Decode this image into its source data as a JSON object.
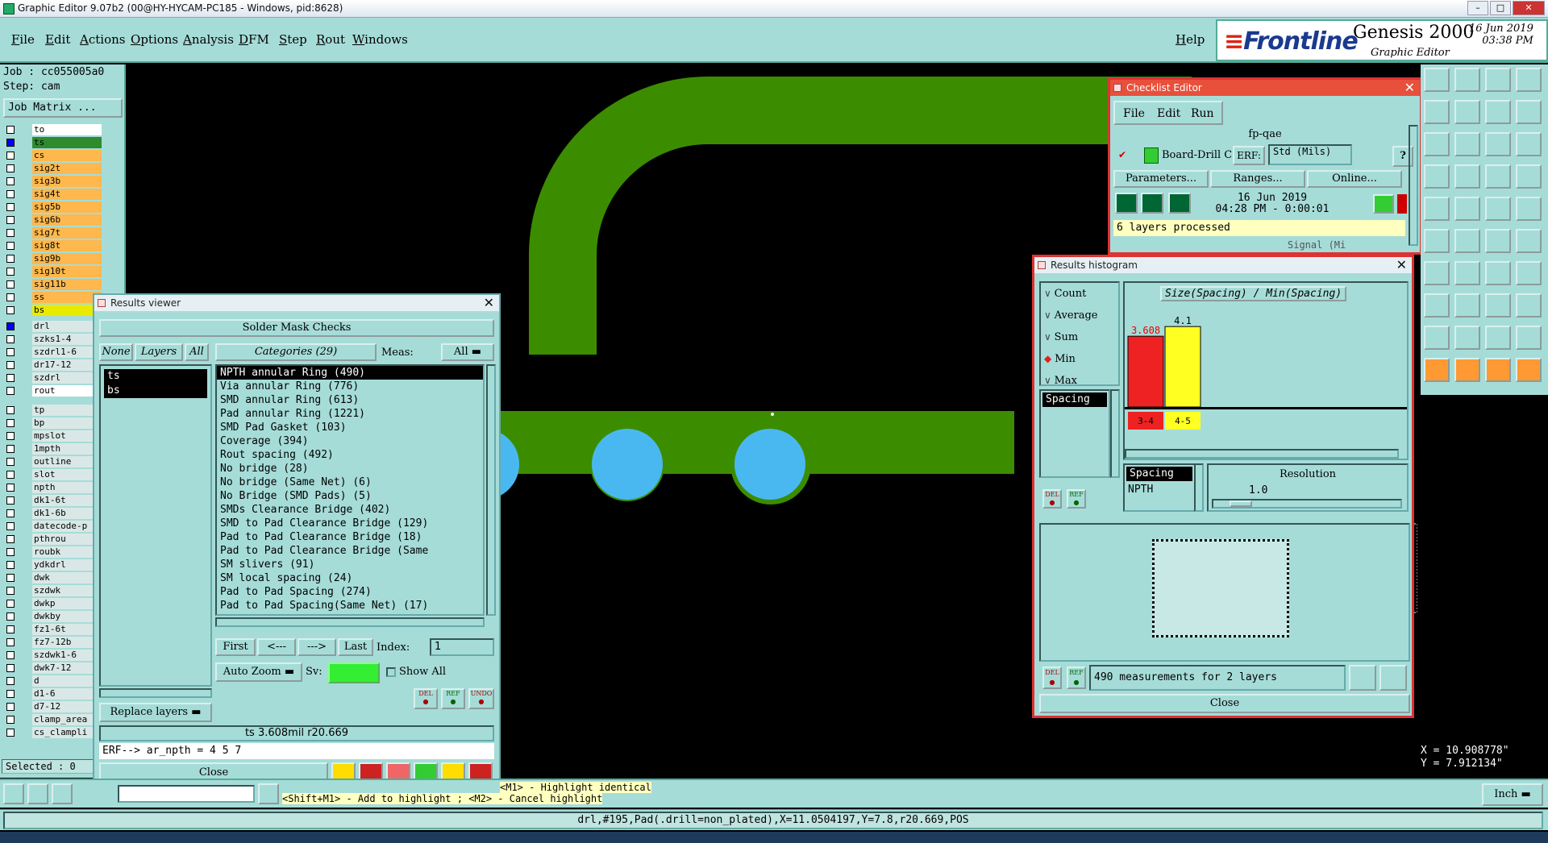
{
  "window": {
    "title": "Graphic Editor 9.07b2 (00@HY-HYCAM-PC185 - Windows, pid:8628)"
  },
  "menu": {
    "items": [
      "File",
      "Edit",
      "Actions",
      "Options",
      "Analysis",
      "DFM",
      "Step",
      "Rout",
      "Windows"
    ],
    "help": "Help"
  },
  "brand": {
    "logo": "Frontline",
    "product": "Genesis 2000",
    "subtitle": "Graphic Editor",
    "date": "16 Jun 2019",
    "time": "03:38 PM"
  },
  "left_panel": {
    "job": "Job : cc055005a0",
    "step": "Step: cam",
    "job_matrix": "Job Matrix ...",
    "layers": [
      {
        "name": "to",
        "style": "white",
        "checked": false
      },
      {
        "name": "ts",
        "style": "green",
        "checked": true
      },
      {
        "name": "cs",
        "style": "orange",
        "checked": false
      },
      {
        "name": "sig2t",
        "style": "orange",
        "checked": false
      },
      {
        "name": "sig3b",
        "style": "orange",
        "checked": false
      },
      {
        "name": "sig4t",
        "style": "orange",
        "checked": false
      },
      {
        "name": "sig5b",
        "style": "orange",
        "checked": false
      },
      {
        "name": "sig6b",
        "style": "orange",
        "checked": false
      },
      {
        "name": "sig7t",
        "style": "orange",
        "checked": false
      },
      {
        "name": "sig8t",
        "style": "orange",
        "checked": false
      },
      {
        "name": "sig9b",
        "style": "orange",
        "checked": false
      },
      {
        "name": "sig10t",
        "style": "orange",
        "checked": false
      },
      {
        "name": "sig11b",
        "style": "orange",
        "checked": false
      },
      {
        "name": "ss",
        "style": "orange",
        "checked": false
      },
      {
        "name": "bs",
        "style": "yellow",
        "checked": false
      },
      {
        "name": "drl",
        "style": "gray",
        "checked": true
      },
      {
        "name": "szks1-4",
        "style": "gray",
        "checked": false
      },
      {
        "name": "szdrl1-6",
        "style": "gray",
        "checked": false
      },
      {
        "name": "dr17-12",
        "style": "gray",
        "checked": false
      },
      {
        "name": "szdrl",
        "style": "gray",
        "checked": false
      },
      {
        "name": "rout",
        "style": "white",
        "checked": false
      },
      {
        "name": "tp",
        "style": "gray",
        "checked": false
      },
      {
        "name": "bp",
        "style": "gray",
        "checked": false
      },
      {
        "name": "mpslot",
        "style": "gray",
        "checked": false
      },
      {
        "name": "1mpth",
        "style": "gray",
        "checked": false
      },
      {
        "name": "outline",
        "style": "gray",
        "checked": false
      },
      {
        "name": "slot",
        "style": "gray",
        "checked": false
      },
      {
        "name": "npth",
        "style": "gray",
        "checked": false
      },
      {
        "name": "dk1-6t",
        "style": "gray",
        "checked": false
      },
      {
        "name": "dk1-6b",
        "style": "gray",
        "checked": false
      },
      {
        "name": "datecode-p",
        "style": "gray",
        "checked": false
      },
      {
        "name": "pthrou",
        "style": "gray",
        "checked": false
      },
      {
        "name": "roubk",
        "style": "gray",
        "checked": false
      },
      {
        "name": "ydkdrl",
        "style": "gray",
        "checked": false
      },
      {
        "name": "dwk",
        "style": "gray",
        "checked": false
      },
      {
        "name": "szdwk",
        "style": "gray",
        "checked": false
      },
      {
        "name": "dwkp",
        "style": "gray",
        "checked": false
      },
      {
        "name": "dwkby",
        "style": "gray",
        "checked": false
      },
      {
        "name": "fz1-6t",
        "style": "gray",
        "checked": false
      },
      {
        "name": "fz7-12b",
        "style": "gray",
        "checked": false
      },
      {
        "name": "szdwk1-6",
        "style": "gray",
        "checked": false
      },
      {
        "name": "dwk7-12",
        "style": "gray",
        "checked": false
      },
      {
        "name": "d",
        "style": "gray",
        "checked": false
      },
      {
        "name": "d1-6",
        "style": "gray",
        "checked": false
      },
      {
        "name": "d7-12",
        "style": "gray",
        "checked": false
      },
      {
        "name": "clamp_area",
        "style": "gray",
        "checked": false
      },
      {
        "name": "cs_clampli",
        "style": "gray",
        "checked": false
      }
    ],
    "selected": "Selected : 0"
  },
  "results_viewer": {
    "title": "Results viewer",
    "header": "Solder Mask Checks",
    "none_btn": "None",
    "layers_btn": "Layers",
    "all_btn": "All",
    "categories_btn": "Categories (29)",
    "meas_label": "Meas:",
    "meas_value": "All",
    "layer_list": [
      "ts",
      "bs"
    ],
    "categories": [
      "NPTH annular Ring (490)",
      "Via annular Ring (776)",
      "SMD annular Ring (613)",
      "Pad annular Ring (1221)",
      "SMD Pad Gasket (103)",
      "Coverage (394)",
      "Rout spacing (492)",
      "No bridge (28)",
      "No bridge (Same Net) (6)",
      "No Bridge (SMD Pads) (5)",
      "SMDs Clearance Bridge (402)",
      "SMD to Pad Clearance Bridge (129)",
      "Pad to Pad Clearance Bridge (18)",
      "Pad to Pad Clearance Bridge (Same",
      "SM slivers (91)",
      "SM local spacing (24)",
      "Pad to Pad Spacing (274)",
      "Pad to Pad Spacing(Same Net) (17)"
    ],
    "first": "First",
    "prev": "<---",
    "next": "--->",
    "last": "Last",
    "index_label": "Index:",
    "index_value": "1",
    "replace_layers": "Replace layers",
    "auto_zoom": "Auto Zoom",
    "sv_label": "Sv:",
    "show_all": "Show All",
    "del": "DEL",
    "ref": "REF",
    "undo": "UNDO",
    "status": "ts 3.608mil  r20.669",
    "erf": "ERF--> ar_npth = 4 5 7",
    "close": "Close"
  },
  "checklist_editor": {
    "title": "Checklist Editor",
    "menu": [
      "File",
      "Edit",
      "Run"
    ],
    "name": "fp-qae",
    "check_name": "Board-Drill Che",
    "erf_label": "ERF:",
    "erf_value": "Std (Mils)",
    "help": "?",
    "params": "Parameters...",
    "ranges": "Ranges...",
    "online": "Online...",
    "run_date": "16 Jun 2019",
    "run_time": "04:28 PM - 0:00:01",
    "processed": "6 layers processed",
    "next_erf": "Signal (Mi"
  },
  "histogram": {
    "title": "Results histogram",
    "options": [
      "Count",
      "Average",
      "Sum",
      "Min",
      "Max"
    ],
    "selected_option": "Min",
    "chart_title": "Size(Spacing) / Min(Spacing)",
    "filter_list": [
      "Spacing"
    ],
    "del": "DEL",
    "ref": "REF",
    "legend_1": "Spacing",
    "legend_2": "NPTH",
    "resolution_label": "Resolution",
    "resolution_value": "1.0",
    "summary": "490 measurements for 2 layers",
    "close": "Close",
    "colors": {
      "bar1": "#ee2222",
      "bar2": "#ffff22"
    }
  },
  "chart_data": {
    "type": "bar",
    "title": "Size(Spacing) / Min(Spacing)",
    "categories": [
      "3-4",
      "4-5"
    ],
    "values": [
      3.608,
      4.1
    ],
    "data_labels": [
      "3.608",
      "4.1"
    ],
    "ylim": [
      0,
      4.6
    ]
  },
  "coords": {
    "x": "X = 10.908778\"",
    "y": "Y = 7.912134\""
  },
  "bottom": {
    "hint1": "<M1> - Highlight identical",
    "hint2": "<Shift+M1> - Add to highlight ; <M2> - Cancel highlight",
    "unit": "Inch",
    "status": "drl,#195,Pad(.drill=non_plated),X=11.0504197,Y=7.8,r20.669,POS"
  }
}
